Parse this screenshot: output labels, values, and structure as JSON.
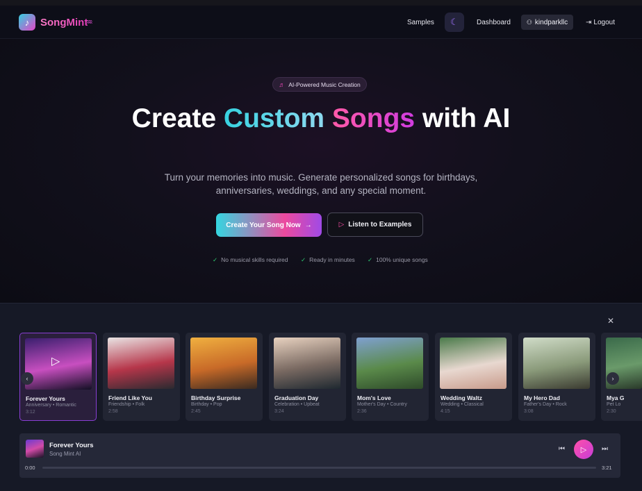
{
  "brand": {
    "name": "SongMint",
    "accent": "#e546c8"
  },
  "nav": {
    "samples": "Samples",
    "dashboard": "Dashboard",
    "username": "kindparkllc",
    "logout": "Logout",
    "theme_icon": "moon-icon"
  },
  "hero": {
    "badge": "AI-Powered Music Creation",
    "title_part1": "Create ",
    "title_highlight1": "Custom",
    "title_space": " ",
    "title_highlight2": "Songs",
    "title_part2": " with AI",
    "subtitle": "Turn your memories into music. Generate personalized songs for birthdays, anniversaries, weddings, and any special moment.",
    "cta_primary": "Create Your Song Now",
    "cta_secondary": "Listen to Examples",
    "checks": [
      "No musical skills required",
      "Ready in minutes",
      "100% unique songs"
    ]
  },
  "samples": [
    {
      "title": "Forever Yours",
      "meta": "Anniversary • Romantic",
      "duration": "3:12",
      "colors": [
        "#3a1f6e",
        "#c84fc0",
        "#120f24"
      ]
    },
    {
      "title": "Friend Like You",
      "meta": "Friendship • Folk",
      "duration": "2:58",
      "colors": [
        "#e9e4e4",
        "#b6364a",
        "#2a2a30"
      ]
    },
    {
      "title": "Birthday Surprise",
      "meta": "Birthday • Pop",
      "duration": "2:45",
      "colors": [
        "#f0b040",
        "#c86a28",
        "#3a2a20"
      ]
    },
    {
      "title": "Graduation Day",
      "meta": "Celebration • Upbeat",
      "duration": "3:24",
      "colors": [
        "#e8d2c0",
        "#7a6a62",
        "#1e2830"
      ]
    },
    {
      "title": "Mom's Love",
      "meta": "Mother's Day • Country",
      "duration": "2:36",
      "colors": [
        "#7fa0d0",
        "#5a8a4a",
        "#2e4a2a"
      ]
    },
    {
      "title": "Wedding Waltz",
      "meta": "Wedding • Classical",
      "duration": "4:15",
      "colors": [
        "#4a7a4a",
        "#e8d8d0",
        "#c89a8a"
      ]
    },
    {
      "title": "My Hero Dad",
      "meta": "Father's Day • Rock",
      "duration": "3:08",
      "colors": [
        "#d0dcc8",
        "#8a9a7a",
        "#3a3a30"
      ]
    },
    {
      "title": "Mya G",
      "meta": "Pet Lo",
      "duration": "2:30",
      "colors": [
        "#3a6a4a",
        "#6a9a6a",
        "#2a3a2a"
      ]
    }
  ],
  "player": {
    "title": "Forever Yours",
    "artist": "Song Mint AI",
    "time_current": "0:00",
    "time_total": "3:21",
    "progress": 0
  }
}
